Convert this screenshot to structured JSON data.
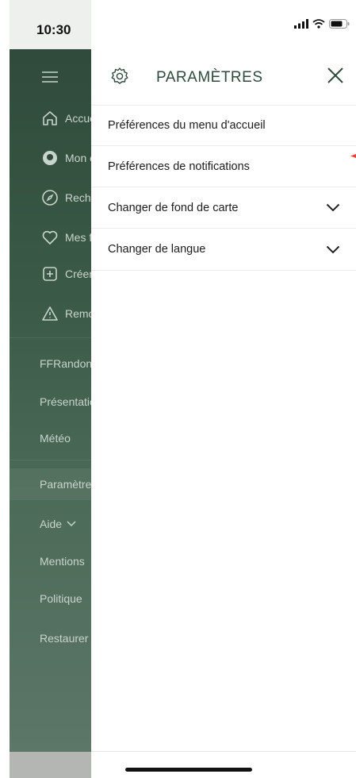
{
  "status_bar": {
    "time": "10:30"
  },
  "sidebar": {
    "items": [
      {
        "label": "Accueil",
        "icon": "home-icon"
      },
      {
        "label": "Mon compte",
        "icon": "profile-icon"
      },
      {
        "label": "Rechercher",
        "icon": "compass-icon"
      },
      {
        "label": "Mes favoris",
        "icon": "heart-icon"
      },
      {
        "label": "Créer",
        "icon": "plus-square-icon"
      },
      {
        "label": "Remonter",
        "icon": "warning-icon"
      }
    ],
    "links_1": [
      "FFRandonnée",
      "Présentation",
      "Météo"
    ],
    "links_2": [
      "Paramètres",
      "Aide",
      "Mentions",
      "Politique",
      "Restaurer"
    ]
  },
  "panel": {
    "title": "PARAMÈTRES",
    "items": [
      {
        "label": "Préférences du menu d'accueil"
      },
      {
        "label": "Préférences de notifications"
      },
      {
        "label": "Changer de fond de carte"
      },
      {
        "label": "Changer de langue"
      }
    ]
  },
  "colors": {
    "sidebar_green": "#304a3b",
    "title_green": "#2f4a3a",
    "marker_red": "#e8452c"
  }
}
